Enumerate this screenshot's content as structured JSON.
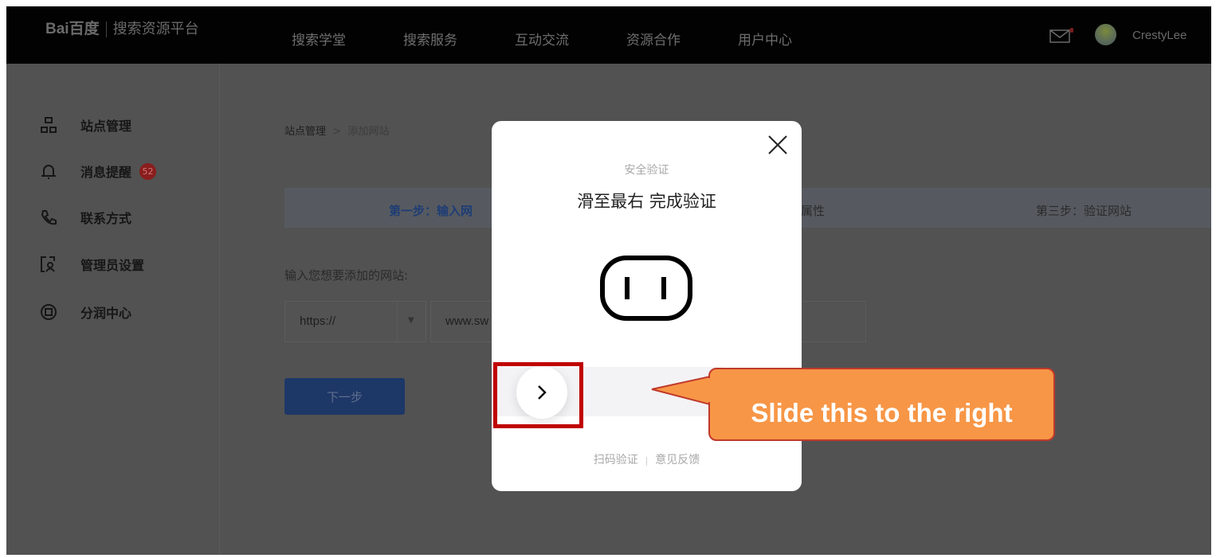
{
  "header": {
    "logo_text": "Bai百度",
    "platform": "搜索资源平台",
    "nav": [
      "搜索学堂",
      "搜索服务",
      "互动交流",
      "资源合作",
      "用户中心"
    ],
    "username": "CrestyLee",
    "mail_icon": "mail-icon"
  },
  "sidebar": {
    "items": [
      {
        "label": "站点管理",
        "icon": "sitemap-icon"
      },
      {
        "label": "消息提醒",
        "icon": "bell-icon",
        "badge": "52"
      },
      {
        "label": "联系方式",
        "icon": "phone-icon"
      },
      {
        "label": "管理员设置",
        "icon": "admin-icon"
      },
      {
        "label": "分润中心",
        "icon": "share-icon"
      }
    ]
  },
  "breadcrumb": {
    "root": "站点管理",
    "sep": ">",
    "current": "添加网站"
  },
  "steps": {
    "step1": "第一步：输入网",
    "step2": "属性",
    "step3": "第三步：验证网站"
  },
  "form": {
    "label": "输入您想要添加的网站:",
    "protocol": "https://",
    "url": "www.sw",
    "next": "下一步"
  },
  "captcha": {
    "title": "安全验证",
    "instruction": "滑至最右 完成验证",
    "scan": "扫码验证",
    "divider": "|",
    "feedback": "意见反馈",
    "slider_progress": 0
  },
  "annotation": {
    "text": "Slide this to the right",
    "color": "#f79646",
    "box_color": "#c00000"
  }
}
